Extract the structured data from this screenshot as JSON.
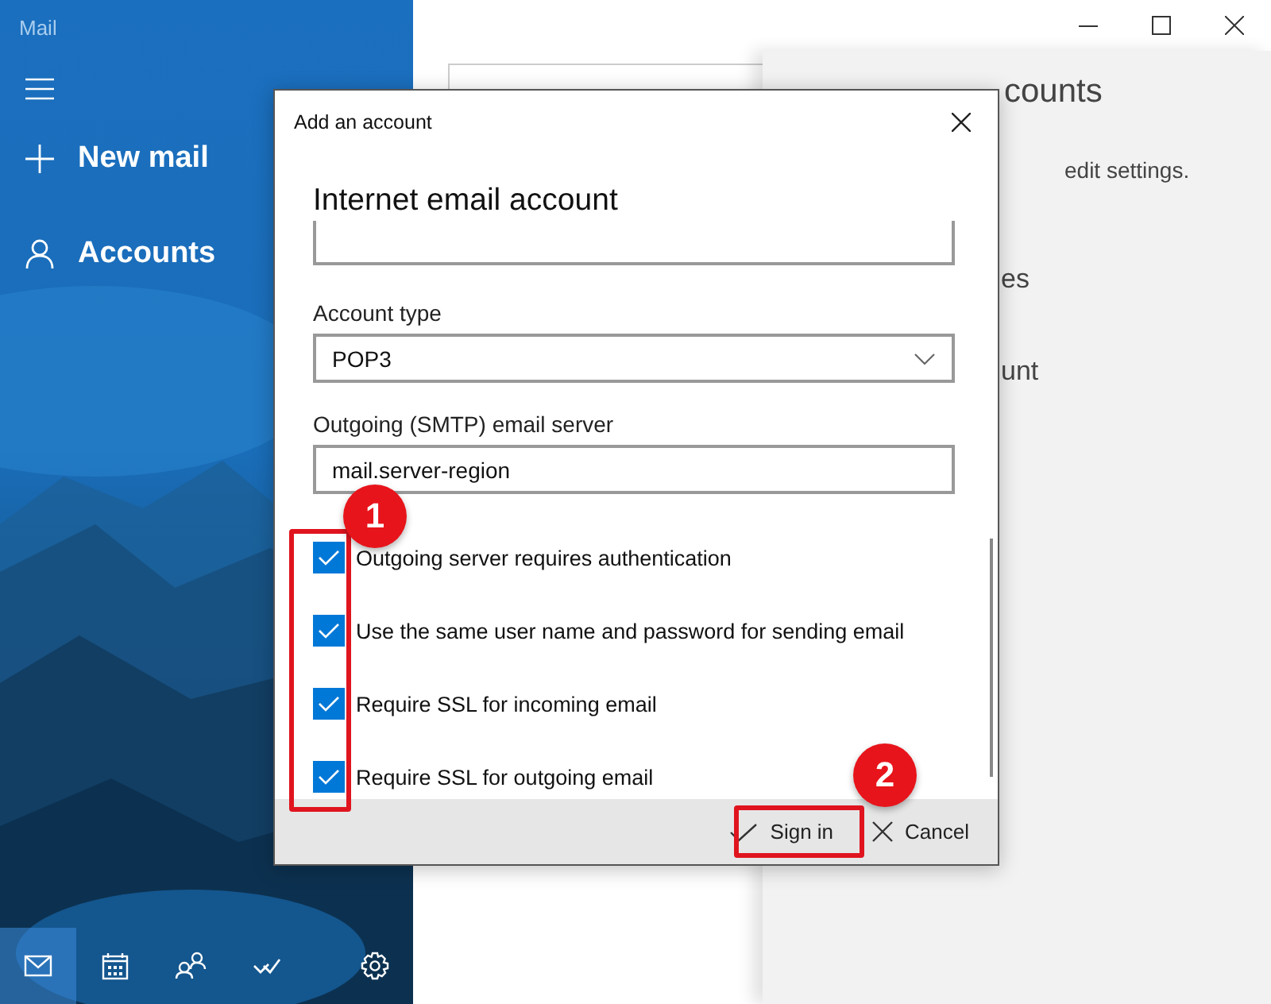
{
  "app": {
    "title": "Mail"
  },
  "sidebar": {
    "items": [
      {
        "kind": "compose",
        "label": "New mail"
      },
      {
        "kind": "accounts",
        "label": "Accounts"
      }
    ],
    "bottom_nav": [
      {
        "kind": "mail",
        "selected": true
      },
      {
        "kind": "calendar",
        "selected": false
      },
      {
        "kind": "people",
        "selected": false
      },
      {
        "kind": "todo",
        "selected": false
      },
      {
        "kind": "settings",
        "selected": false
      }
    ]
  },
  "manage_panel": {
    "title": "counts",
    "fragments": [
      "edit settings.",
      "es",
      "unt"
    ]
  },
  "dialog": {
    "title": "Add an account",
    "heading": "Internet email account",
    "account_type": {
      "label": "Account type",
      "value": "POP3"
    },
    "smtp": {
      "label": "Outgoing (SMTP) email server",
      "value": "mail.server-region"
    },
    "options": [
      {
        "label": "Outgoing server requires authentication",
        "checked": true
      },
      {
        "label": "Use the same user name and password for sending email",
        "checked": true
      },
      {
        "label": "Require SSL for incoming email",
        "checked": true
      },
      {
        "label": "Require SSL for outgoing email",
        "checked": true
      }
    ],
    "buttons": [
      {
        "kind": "confirm",
        "label": "Sign in"
      },
      {
        "kind": "cancel",
        "label": "Cancel"
      }
    ]
  },
  "annotations": [
    {
      "number": "1"
    },
    {
      "number": "2"
    }
  ]
}
